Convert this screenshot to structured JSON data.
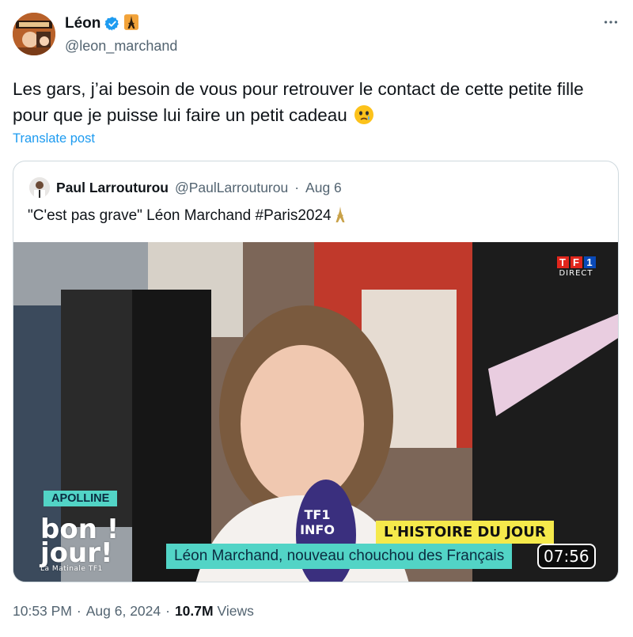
{
  "author": {
    "display_name": "Léon",
    "handle": "@leon_marchand",
    "flag_emoji": "🗼",
    "verified": true
  },
  "menu": {
    "icon": "more-horizontal-icon"
  },
  "tweet": {
    "text": "Les gars, j’ai besoin de vous pour retrouver le contact de cette petite fille pour que je puisse lui faire un petit cadeau",
    "emoji": "face-holding-back-tears-icon",
    "translate_label": "Translate post"
  },
  "quote": {
    "display_name": "Paul Larrouturou",
    "handle": "@PaulLarrouturou",
    "separator": "·",
    "date": "Aug 6",
    "text": "\"C'est pas grave\" Léon Marchand #Paris2024",
    "media": {
      "channel_top": [
        "T",
        "F",
        "1"
      ],
      "channel_sub": "DIRECT",
      "name_tag": "APOLLINE",
      "show_line1": "bon !",
      "show_line2": "jour!",
      "show_line3": "La Matinale TF1",
      "mic_line1": "TF1",
      "mic_line2": "INFO",
      "segment_title": "L'HISTOIRE DU JOUR",
      "caption": "Léon Marchand, nouveau chouchou des Français",
      "timestamp": "07:56"
    }
  },
  "footer": {
    "time": "10:53 PM",
    "dot1": "·",
    "date": "Aug 6, 2024",
    "dot2": "·",
    "views_count": "10.7M",
    "views_label": "Views"
  },
  "colors": {
    "link": "#1d9bf0",
    "secondary": "#536471",
    "verified": "#1d9bf0",
    "border": "#cfd9de"
  }
}
